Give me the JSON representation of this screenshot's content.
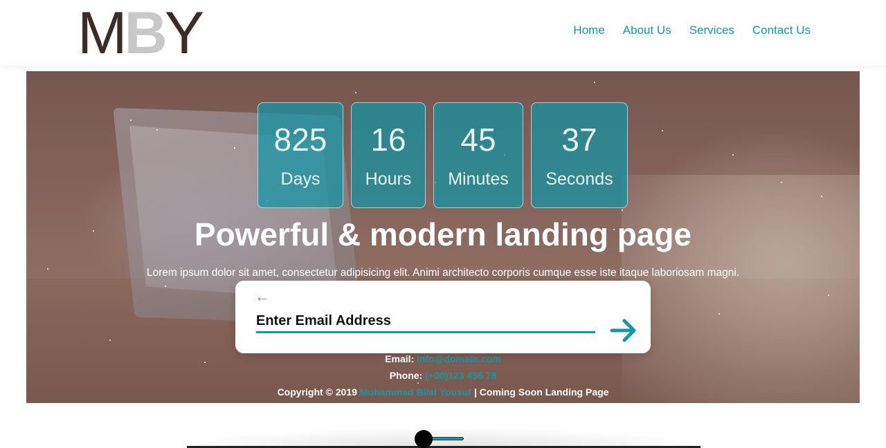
{
  "header": {
    "logo": {
      "part1": "M",
      "part2": "B",
      "part3": "Y"
    },
    "nav": [
      {
        "label": "Home"
      },
      {
        "label": "About Us"
      },
      {
        "label": "Services"
      },
      {
        "label": "Contact Us"
      }
    ]
  },
  "countdown": [
    {
      "value": "825",
      "label": "Days"
    },
    {
      "value": "16",
      "label": "Hours"
    },
    {
      "value": "45",
      "label": "Minutes"
    },
    {
      "value": "37",
      "label": "Seconds"
    }
  ],
  "hero": {
    "headline": "Powerful & modern landing page",
    "subtext": "Lorem ipsum dolor sit amet, consectetur adipisicing elit. Animi architecto corporis cumque esse iste itaque laboriosam magni."
  },
  "email_form": {
    "placeholder": "Enter Email Address",
    "back_icon": "arrow-left-icon",
    "submit_icon": "arrow-right-icon"
  },
  "contact": {
    "email_label": "Email:",
    "email_value": "info@domain.com",
    "phone_label": "Phone:",
    "phone_value": "(+00)123 456 78",
    "copyright_prefix": "Copyright © 2019",
    "copyright_author": "Muhammad Bilal Yousuf",
    "copyright_suffix": "| Coming Soon Landing Page"
  },
  "colors": {
    "accent": "#1596a8",
    "logo_dark": "#3b2c2a",
    "logo_light": "#c8c8c8"
  }
}
